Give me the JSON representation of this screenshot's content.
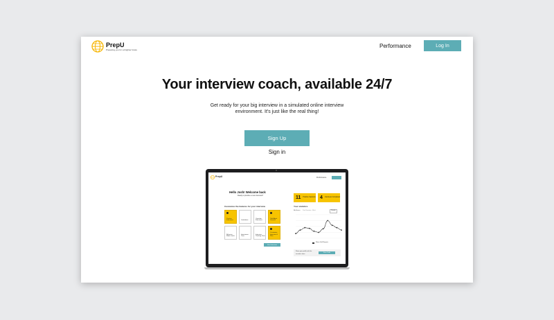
{
  "brand": {
    "name": "PrepU",
    "tagline": "Preparing you for a brighter future",
    "accent": "#5dadb5",
    "logo_color": "#f7b500"
  },
  "nav": {
    "performance_label": "Performance",
    "login_label": "Log In"
  },
  "hero": {
    "title": "Your interview coach, available 24/7",
    "subtitle": "Get ready for your big interview in a simulated online interview environment. It's just like the real thing!",
    "signup_label": "Sign Up",
    "signin_label": "Sign in"
  },
  "mockup": {
    "brand": "PrepU",
    "nav_link": "Performance",
    "nav_button": "Log Out",
    "greeting": "Hello Josh! Welcome back",
    "greeting_sub": "Ready to practice a new interview?",
    "stats": [
      {
        "number": "11",
        "label": "Practice Sessions"
      },
      {
        "number": "4",
        "label": "Interviews Completed"
      }
    ],
    "features_title": "Customize the features for your interview",
    "features": [
      {
        "label": "Practice Interviews",
        "highlight": true
      },
      {
        "label": "Limitations",
        "highlight": false
      },
      {
        "label": "Question Interviews",
        "highlight": false
      },
      {
        "label": "Talk About Yourself",
        "highlight": true
      },
      {
        "label": "Behavior Mode Limits",
        "highlight": false
      },
      {
        "label": "Interviewer Time",
        "highlight": false
      },
      {
        "label": "Interview Thinking Time",
        "highlight": false
      },
      {
        "label": "Customize Interview & Plan",
        "highlight": true
      }
    ],
    "start_button": "Start Interview",
    "stats_title": "Your statistics",
    "stats_tabs": [
      "My Scores",
      "Past Sessions",
      "Mock"
    ],
    "stats_filter": "Weekly",
    "legend": "Mean Self Reports",
    "share_text": "Share your profile with the recruiters team",
    "share_button": "Share Profile",
    "series": [
      0.2,
      0.35,
      0.45,
      0.42,
      0.3,
      0.25,
      0.4,
      0.75,
      0.55,
      0.45,
      0.35
    ]
  }
}
